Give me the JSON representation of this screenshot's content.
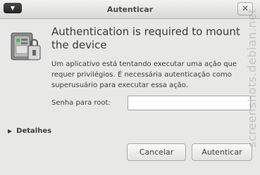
{
  "window": {
    "title": "Autenticar",
    "menu_glyph": "▼",
    "close_glyph": "✕"
  },
  "icon": "security-lock-icon",
  "heading": "Authentication is required to mount the device",
  "description": "Um aplicativo está tentando executar uma ação que requer privilégios. É necessária autenticação como superusuário para executar essa ação.",
  "password": {
    "label": "Senha para root:",
    "value": ""
  },
  "details": {
    "label": "Detalhes",
    "expander_glyph": "▶"
  },
  "buttons": {
    "cancel": "Cancelar",
    "authenticate": "Autenticar"
  },
  "watermark": "screenshots.debian.net",
  "colors": {
    "window_bg": "#e8e8e7",
    "text": "#3c3c3c"
  }
}
